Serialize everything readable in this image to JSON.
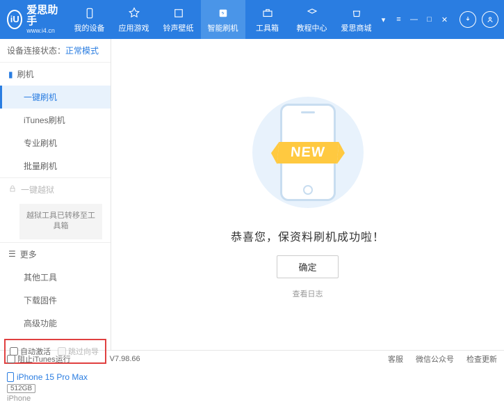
{
  "header": {
    "logo_letter": "iU",
    "app_name": "爱思助手",
    "url": "www.i4.cn"
  },
  "nav": {
    "my_device": "我的设备",
    "app_games": "应用游戏",
    "ringtone": "铃声壁纸",
    "smart_flash": "智能刷机",
    "toolbox": "工具箱",
    "tutorial": "教程中心",
    "mall": "爱思商城"
  },
  "sidebar": {
    "status_label": "设备连接状态：",
    "status_value": "正常模式",
    "flash_section": "刷机",
    "items": {
      "one_key": "一键刷机",
      "itunes": "iTunes刷机",
      "pro": "专业刷机",
      "batch": "批量刷机"
    },
    "jailbreak_section": "一键越狱",
    "jailbreak_tip": "越狱工具已转移至工具箱",
    "more_section": "更多",
    "more_items": {
      "other_tools": "其他工具",
      "download_fw": "下载固件",
      "advanced": "高级功能"
    },
    "checkboxes": {
      "auto_activate": "自动激活",
      "skip_guide": "跳过向导"
    },
    "device": {
      "name": "iPhone 15 Pro Max",
      "storage": "512GB",
      "type": "iPhone"
    }
  },
  "main": {
    "new_badge": "NEW",
    "success": "恭喜您，保资料刷机成功啦！",
    "ok_button": "确定",
    "view_log": "查看日志"
  },
  "footer": {
    "block_itunes": "阻止iTunes运行",
    "version": "V7.98.66",
    "service": "客服",
    "wechat": "微信公众号",
    "update": "检查更新"
  }
}
